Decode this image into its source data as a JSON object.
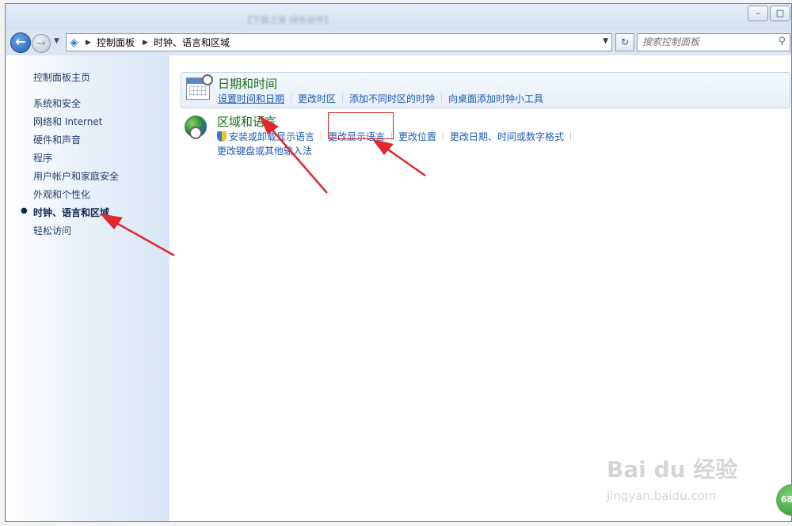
{
  "window": {
    "title": "【下载之家 绿色软件】",
    "minimize_symbol": "–",
    "maximize_symbol": "□"
  },
  "address": {
    "crumbs": [
      "控制面板",
      "时钟、语言和区域"
    ],
    "search_placeholder": "搜索控制面板"
  },
  "sidebar": {
    "home": "控制面板主页",
    "items": [
      {
        "label": "系统和安全"
      },
      {
        "label": "网络和 Internet"
      },
      {
        "label": "硬件和声音"
      },
      {
        "label": "程序"
      },
      {
        "label": "用户帐户和家庭安全"
      },
      {
        "label": "外观和个性化"
      },
      {
        "label": "时钟、语言和区域",
        "active": true
      },
      {
        "label": "轻松访问"
      }
    ]
  },
  "categories": [
    {
      "title": "日期和时间",
      "icon": "calendar-clock-icon",
      "links": [
        "设置时间和日期",
        "更改时区",
        "添加不同时区的时钟",
        "向桌面添加时钟小工具"
      ]
    },
    {
      "title": "区域和语言",
      "icon": "globe-clock-icon",
      "links": [
        "安装或卸载显示语言",
        "更改显示语言",
        "更改位置",
        "更改日期、时间或数字格式"
      ],
      "links_row2": [
        "更改键盘或其他输入法"
      ]
    }
  ],
  "watermark": {
    "brand": "Bai du 经验",
    "url": "jingyan.baidu.com",
    "badge": "68"
  },
  "colors": {
    "link": "#1e5bb5",
    "category_title": "#1c6b1c",
    "annotation": "#e0282e"
  }
}
